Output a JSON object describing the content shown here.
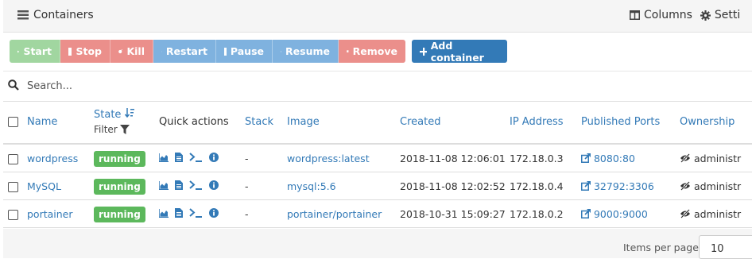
{
  "header": {
    "title": "Containers",
    "columns_label": "Columns",
    "settings_label": "Setti"
  },
  "toolbar": {
    "start": "Start",
    "stop": "Stop",
    "kill": "Kill",
    "restart": "Restart",
    "pause": "Pause",
    "resume": "Resume",
    "remove": "Remove",
    "add_container": "Add container"
  },
  "search": {
    "placeholder": "Search..."
  },
  "table": {
    "columns": {
      "name": "Name",
      "state": "State",
      "filter": "Filter",
      "quick_actions": "Quick actions",
      "stack": "Stack",
      "image": "Image",
      "created": "Created",
      "ip": "IP Address",
      "ports": "Published Ports",
      "ownership": "Ownership"
    },
    "rows": [
      {
        "name": "wordpress",
        "state": "running",
        "stack": "-",
        "image": "wordpress:latest",
        "created": "2018-11-08 12:06:01",
        "ip": "172.18.0.3",
        "ports": "8080:80",
        "ownership": "administr"
      },
      {
        "name": "MySQL",
        "state": "running",
        "stack": "-",
        "image": "mysql:5.6",
        "created": "2018-11-08 12:02:52",
        "ip": "172.18.0.4",
        "ports": "32792:3306",
        "ownership": "administr"
      },
      {
        "name": "portainer",
        "state": "running",
        "stack": "-",
        "image": "portainer/portainer",
        "created": "2018-10-31 15:09:27",
        "ip": "172.18.0.2",
        "ports": "9000:9000",
        "ownership": "administr"
      }
    ]
  },
  "footer": {
    "items_per_page_label": "Items per page",
    "items_per_page_value": "10"
  },
  "colors": {
    "accent": "#337ab7",
    "running": "#5cb85c",
    "start": "#a1d6a0",
    "danger": "#eb8f8b",
    "info": "#7fb2df"
  }
}
